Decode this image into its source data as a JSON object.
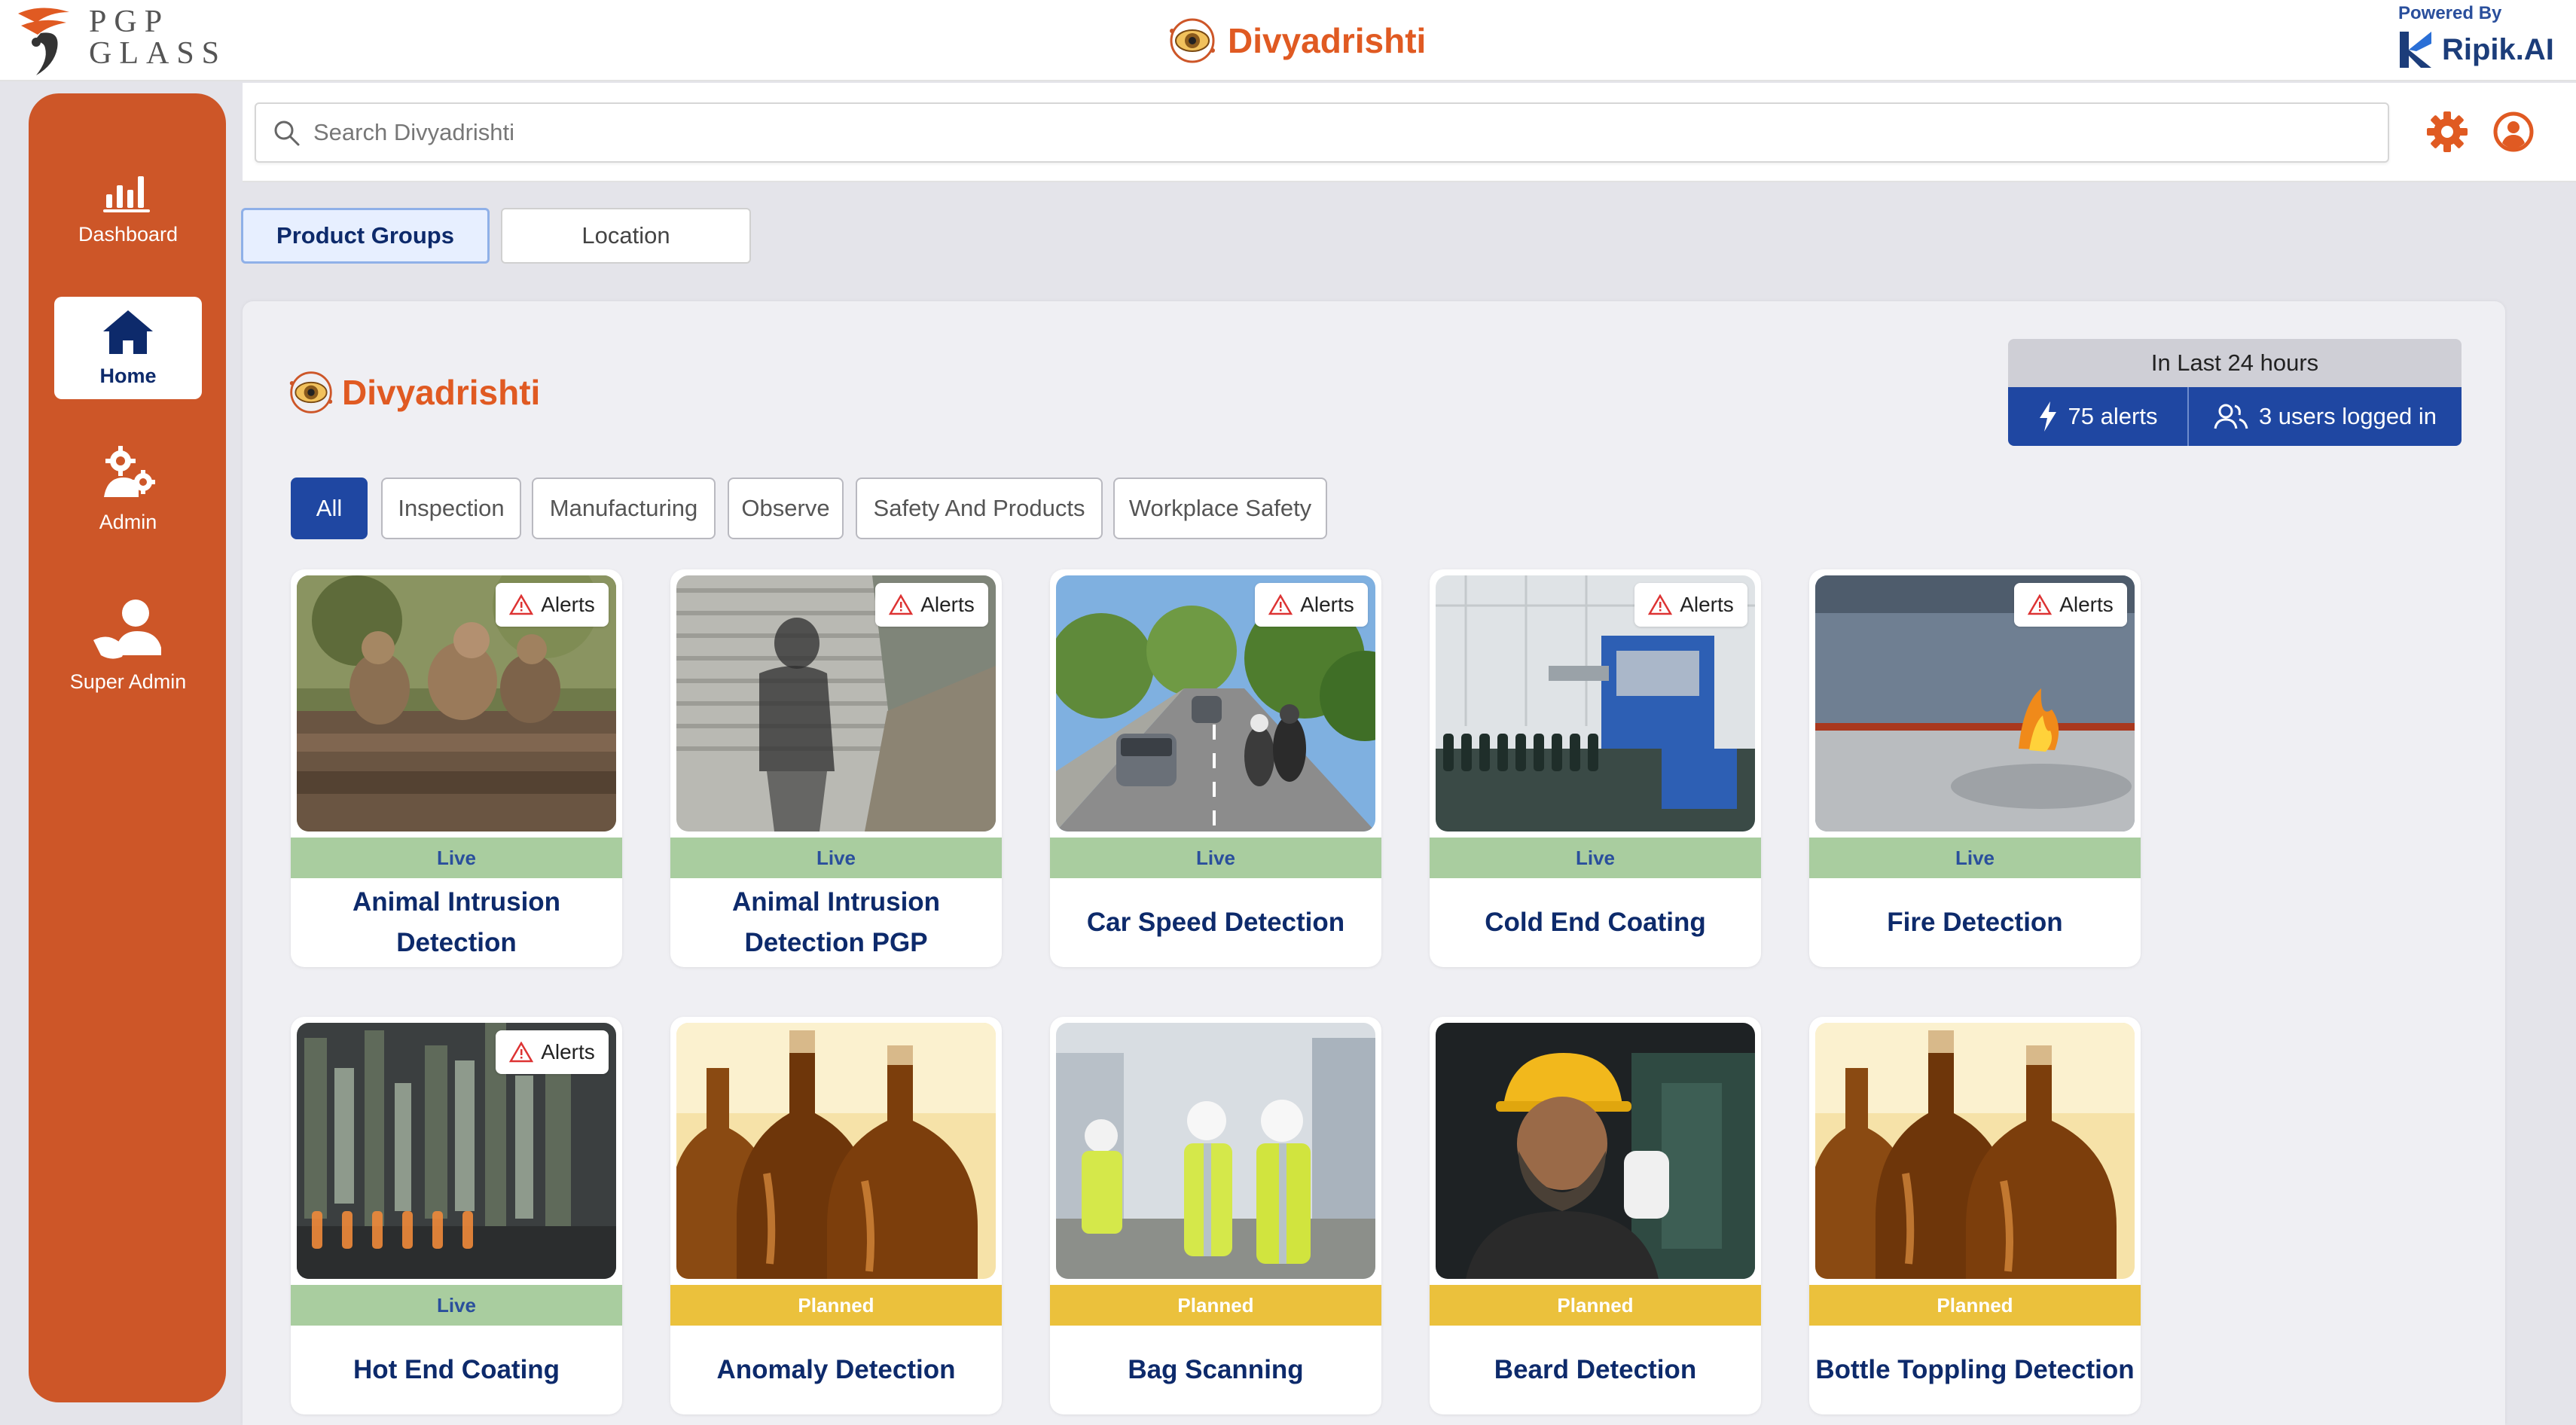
{
  "header": {
    "company_logo_text_line1": "PGP",
    "company_logo_text_line2": "GLASS",
    "app_title": "Divyadrishti",
    "powered_by_label": "Powered By",
    "powered_by_brand": "Ripik.AI"
  },
  "sidebar": {
    "items": [
      {
        "label": "Dashboard",
        "icon": "bar-chart-icon"
      },
      {
        "label": "Home",
        "icon": "home-icon",
        "active": true
      },
      {
        "label": "Admin",
        "icon": "admin-gears-icon"
      },
      {
        "label": "Super Admin",
        "icon": "super-admin-icon"
      }
    ]
  },
  "search": {
    "placeholder": "Search Divyadrishti",
    "value": ""
  },
  "tabs": [
    {
      "label": "Product Groups",
      "active": true
    },
    {
      "label": "Location",
      "active": false
    }
  ],
  "panel": {
    "brand_title": "Divyadrishti",
    "stats": {
      "heading": "In Last 24 hours",
      "alerts": "75 alerts",
      "users": "3 users logged in"
    },
    "filters": [
      {
        "label": "All",
        "active": true
      },
      {
        "label": "Inspection"
      },
      {
        "label": "Manufacturing"
      },
      {
        "label": "Observe"
      },
      {
        "label": "Safety And Products"
      },
      {
        "label": "Workplace Safety"
      }
    ],
    "alerts_label": "Alerts",
    "cards": [
      {
        "title": "Animal Intrusion Detection",
        "status": "Live",
        "alerts": true,
        "image": "monkeys-on-rock"
      },
      {
        "title": "Animal Intrusion Detection PGP",
        "status": "Live",
        "alerts": true,
        "image": "shadow-on-wall"
      },
      {
        "title": "Car Speed Detection",
        "status": "Live",
        "alerts": true,
        "image": "highway-traffic"
      },
      {
        "title": "Cold End Coating",
        "status": "Live",
        "alerts": true,
        "image": "bottle-conveyor"
      },
      {
        "title": "Fire Detection",
        "status": "Live",
        "alerts": true,
        "image": "fire-on-floor"
      },
      {
        "title": "Hot End Coating",
        "status": "Live",
        "alerts": true,
        "image": "glass-forming-machine"
      },
      {
        "title": "Anomaly Detection",
        "status": "Planned",
        "alerts": false,
        "image": "amber-bottles"
      },
      {
        "title": "Bag Scanning",
        "status": "Planned",
        "alerts": false,
        "image": "workers-hard-hats"
      },
      {
        "title": "Beard Detection",
        "status": "Planned",
        "alerts": false,
        "image": "bearded-worker"
      },
      {
        "title": "Bottle Toppling Detection",
        "status": "Planned",
        "alerts": false,
        "image": "amber-bottles"
      }
    ]
  },
  "colors": {
    "accent_orange": "#cd5628",
    "brand_orange": "#e05a22",
    "primary_blue": "#1f47a2",
    "navy_text": "#0d2a6b",
    "live_green": "#a9cd9f",
    "planned_yellow": "#ebc13c"
  }
}
